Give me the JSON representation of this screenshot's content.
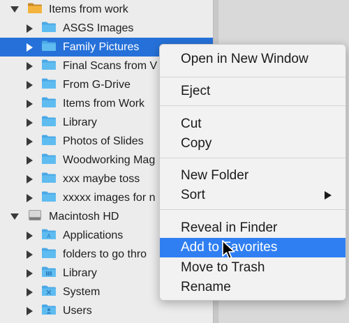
{
  "sidebar": {
    "items": [
      {
        "label": "Items from work",
        "level": 0,
        "expanded": true,
        "icon": "home-folder-icon"
      },
      {
        "label": "ASGS Images",
        "level": 1,
        "icon": "folder-icon"
      },
      {
        "label": "Family Pictures",
        "level": 1,
        "icon": "folder-icon",
        "selected": true
      },
      {
        "label": "Final Scans from V",
        "level": 1,
        "icon": "folder-icon"
      },
      {
        "label": "From G-Drive",
        "level": 1,
        "icon": "folder-icon"
      },
      {
        "label": "Items from Work",
        "level": 1,
        "icon": "folder-icon"
      },
      {
        "label": "Library",
        "level": 1,
        "icon": "folder-icon"
      },
      {
        "label": "Photos of Slides",
        "level": 1,
        "icon": "folder-icon"
      },
      {
        "label": "Woodworking Mag",
        "level": 1,
        "icon": "folder-icon"
      },
      {
        "label": "xxx maybe toss",
        "level": 1,
        "icon": "folder-icon"
      },
      {
        "label": "xxxxx images for n",
        "level": 1,
        "icon": "folder-icon"
      },
      {
        "label": "Macintosh HD",
        "level": 0,
        "expanded": true,
        "icon": "hard-drive-icon"
      },
      {
        "label": "Applications",
        "level": 1,
        "icon": "applications-folder-icon"
      },
      {
        "label": "folders to go thro",
        "level": 1,
        "icon": "folder-icon"
      },
      {
        "label": "Library",
        "level": 1,
        "icon": "library-folder-icon"
      },
      {
        "label": "System",
        "level": 1,
        "icon": "system-folder-icon"
      },
      {
        "label": "Users",
        "level": 1,
        "icon": "users-folder-icon"
      }
    ]
  },
  "context_menu": {
    "items": [
      {
        "label": "Open in New Window"
      },
      {
        "separator": true
      },
      {
        "label": "Eject"
      },
      {
        "separator": true
      },
      {
        "label": "Cut"
      },
      {
        "label": "Copy"
      },
      {
        "separator": true
      },
      {
        "label": "New Folder"
      },
      {
        "label": "Sort",
        "submenu": true
      },
      {
        "separator": true
      },
      {
        "label": "Reveal in Finder"
      },
      {
        "label": "Add to Favorites",
        "highlighted": true
      },
      {
        "label": "Move to Trash"
      },
      {
        "label": "Rename"
      }
    ]
  },
  "colors": {
    "selection": "#2671d9",
    "menu_highlight": "#2f7ff2",
    "folder": "#5fbcf0"
  }
}
